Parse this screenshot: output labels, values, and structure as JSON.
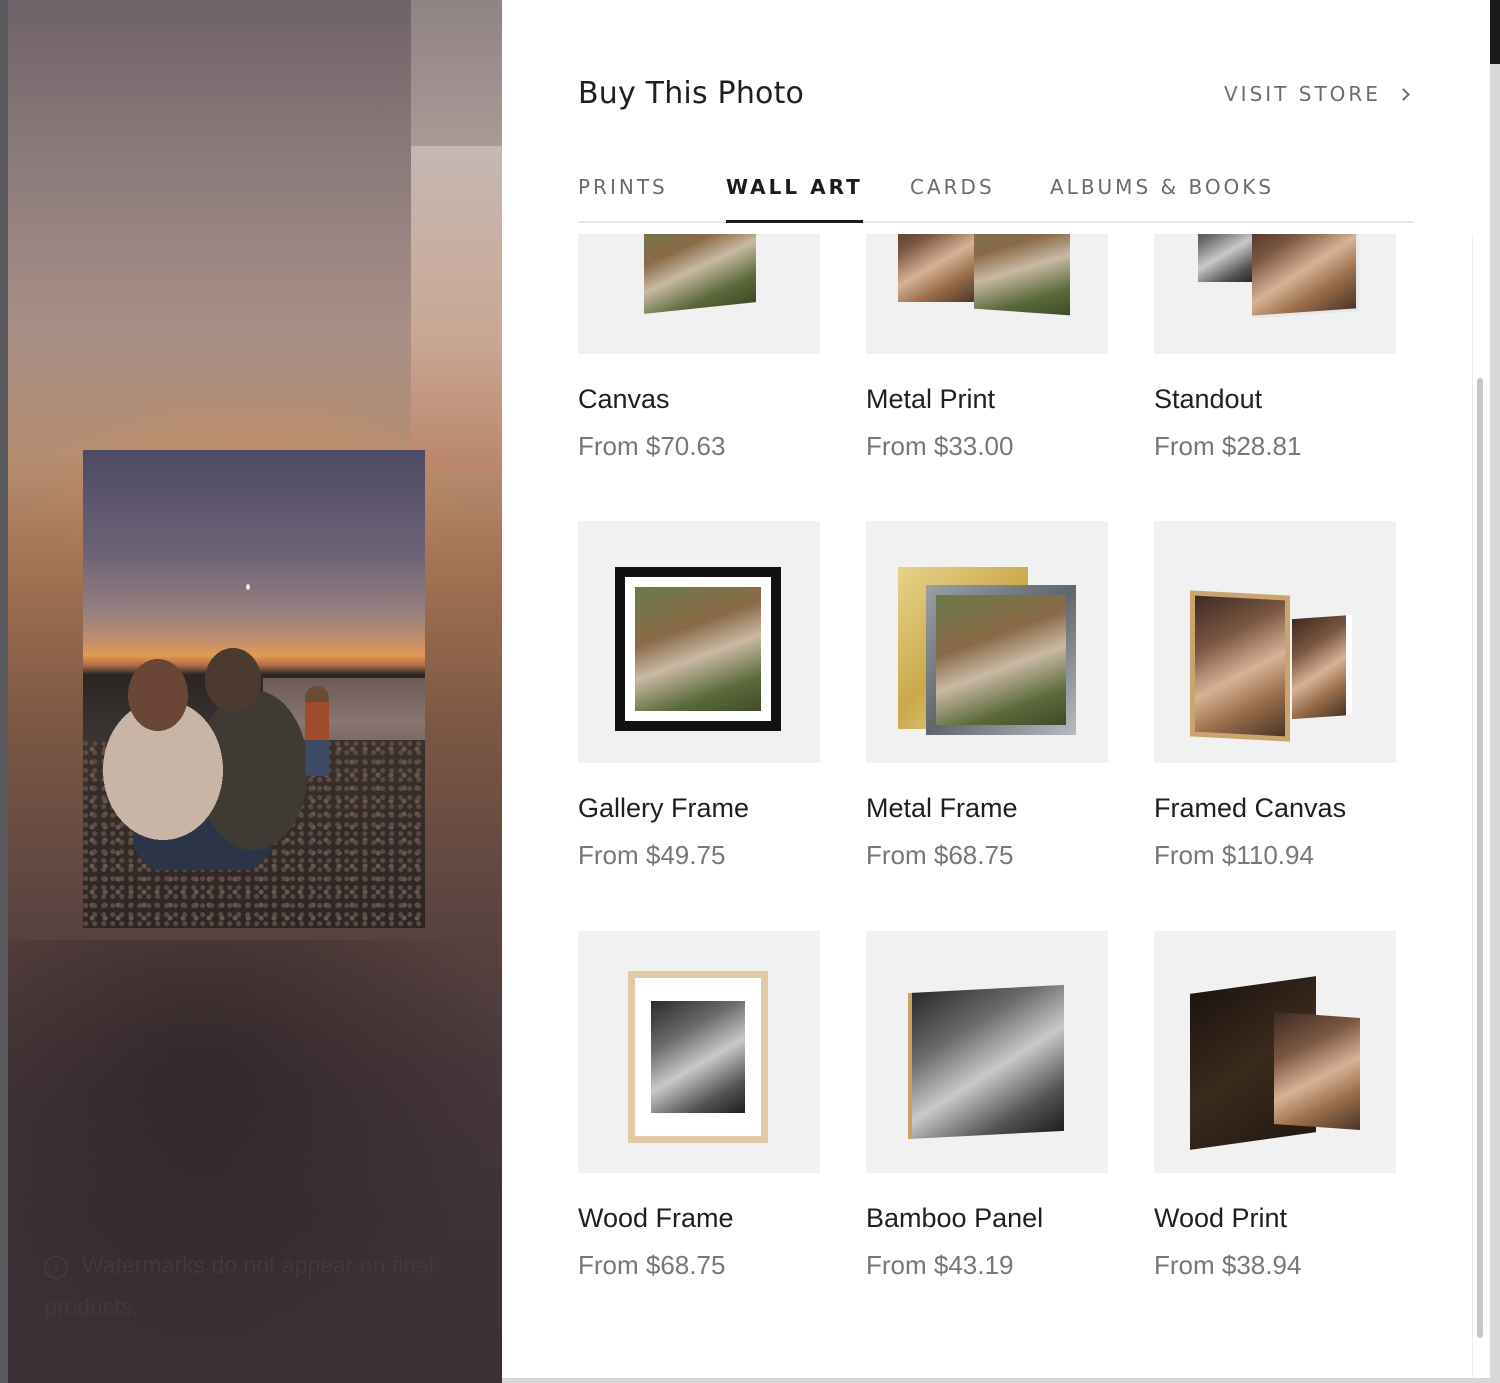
{
  "backdrop": {
    "watermark_note": "Watermarks do not appear on final products."
  },
  "panel": {
    "title": "Buy This Photo",
    "visit_store_label": "VISIT STORE",
    "tabs": [
      {
        "label": "PRINTS",
        "active": false
      },
      {
        "label": "WALL ART",
        "active": true
      },
      {
        "label": "CARDS",
        "active": false
      },
      {
        "label": "ALBUMS & BOOKS",
        "active": false
      }
    ],
    "products": [
      {
        "name": "Canvas",
        "price": "From $70.63"
      },
      {
        "name": "Metal Print",
        "price": "From $33.00"
      },
      {
        "name": "Standout",
        "price": "From $28.81"
      },
      {
        "name": "Gallery Frame",
        "price": "From $49.75"
      },
      {
        "name": "Metal Frame",
        "price": "From $68.75"
      },
      {
        "name": "Framed Canvas",
        "price": "From $110.94"
      },
      {
        "name": "Wood Frame",
        "price": "From $68.75"
      },
      {
        "name": "Bamboo Panel",
        "price": "From $43.19"
      },
      {
        "name": "Wood Print",
        "price": "From $38.94"
      }
    ]
  },
  "colors": {
    "active_tab": "#1c1c1c",
    "inactive_tab": "#6b6b6b",
    "price_text": "#777777",
    "thumb_bg": "#f1f1f1"
  },
  "icons": [
    "chevron-right-icon",
    "info-icon"
  ]
}
